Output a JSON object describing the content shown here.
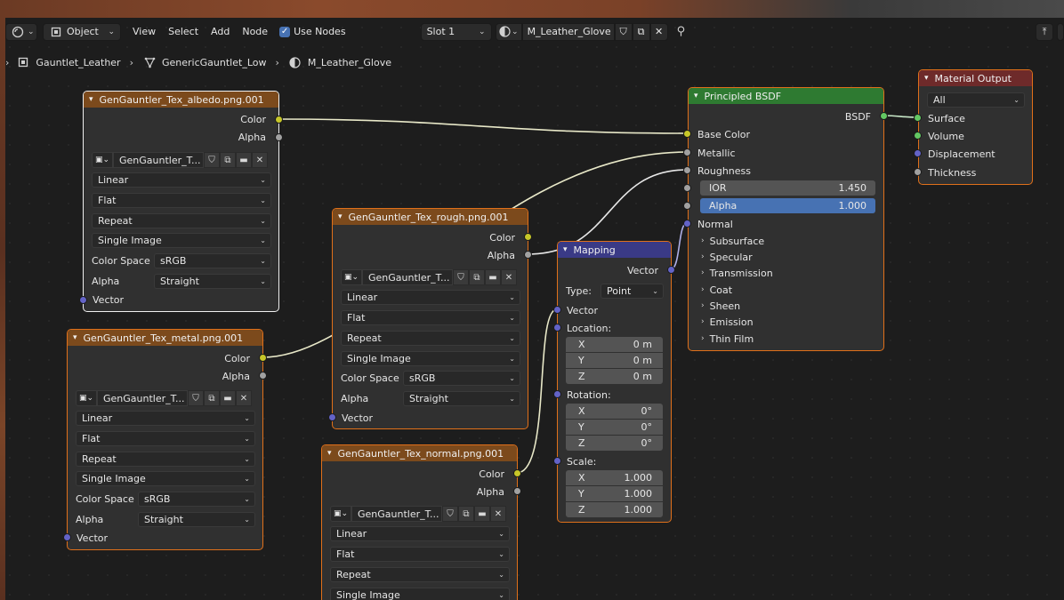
{
  "header": {
    "mode": "Object",
    "menus": [
      "View",
      "Select",
      "Add",
      "Node"
    ],
    "use_nodes_label": "Use Nodes",
    "slot": "Slot 1",
    "material_name": "M_Leather_Glove"
  },
  "breadcrumb": {
    "object": "Gauntlet_Leather",
    "mesh": "GenericGauntlet_Low",
    "material": "M_Leather_Glove"
  },
  "tex_common": {
    "color_out": "Color",
    "alpha_out": "Alpha",
    "image_name": "GenGauntler_T...",
    "interpolation": "Linear",
    "projection": "Flat",
    "extension": "Repeat",
    "source": "Single Image",
    "color_space_label": "Color Space",
    "color_space": "sRGB",
    "alpha_label": "Alpha",
    "alpha_mode": "Straight",
    "vector_in": "Vector"
  },
  "nodes": {
    "albedo": {
      "title": "GenGauntler_Tex_albedo.png.001"
    },
    "metal": {
      "title": "GenGauntler_Tex_metal.png.001"
    },
    "rough": {
      "title": "GenGauntler_Tex_rough.png.001"
    },
    "normal": {
      "title": "GenGauntler_Tex_normal.png.001"
    },
    "mapping": {
      "title": "Mapping",
      "vector_out": "Vector",
      "type_label": "Type:",
      "type_value": "Point",
      "vector_in": "Vector",
      "location_label": "Location:",
      "rotation_label": "Rotation:",
      "scale_label": "Scale:",
      "axes": [
        "X",
        "Y",
        "Z"
      ],
      "location": [
        "0 m",
        "0 m",
        "0 m"
      ],
      "rotation": [
        "0°",
        "0°",
        "0°"
      ],
      "scale": [
        "1.000",
        "1.000",
        "1.000"
      ]
    },
    "bsdf": {
      "title": "Principled BSDF",
      "bsdf_out": "BSDF",
      "base_color": "Base Color",
      "metallic": "Metallic",
      "roughness": "Roughness",
      "ior_label": "IOR",
      "ior_value": "1.450",
      "alpha_label": "Alpha",
      "alpha_value": "1.000",
      "normal": "Normal",
      "panels": [
        "Subsurface",
        "Specular",
        "Transmission",
        "Coat",
        "Sheen",
        "Emission",
        "Thin Film"
      ]
    },
    "output": {
      "title": "Material Output",
      "target": "All",
      "surface": "Surface",
      "volume": "Volume",
      "displacement": "Displacement",
      "thickness": "Thickness"
    }
  },
  "colors": {
    "selected_border": "#e0701a",
    "texture_header": "#7c4a1c",
    "shader_header": "#2e7a31",
    "output_header": "#6e2a2a",
    "vector_header": "#3a3a86",
    "color_socket": "#c7c729",
    "float_socket": "#a1a1a1",
    "vector_socket": "#6363c7",
    "shader_socket": "#63c763"
  }
}
